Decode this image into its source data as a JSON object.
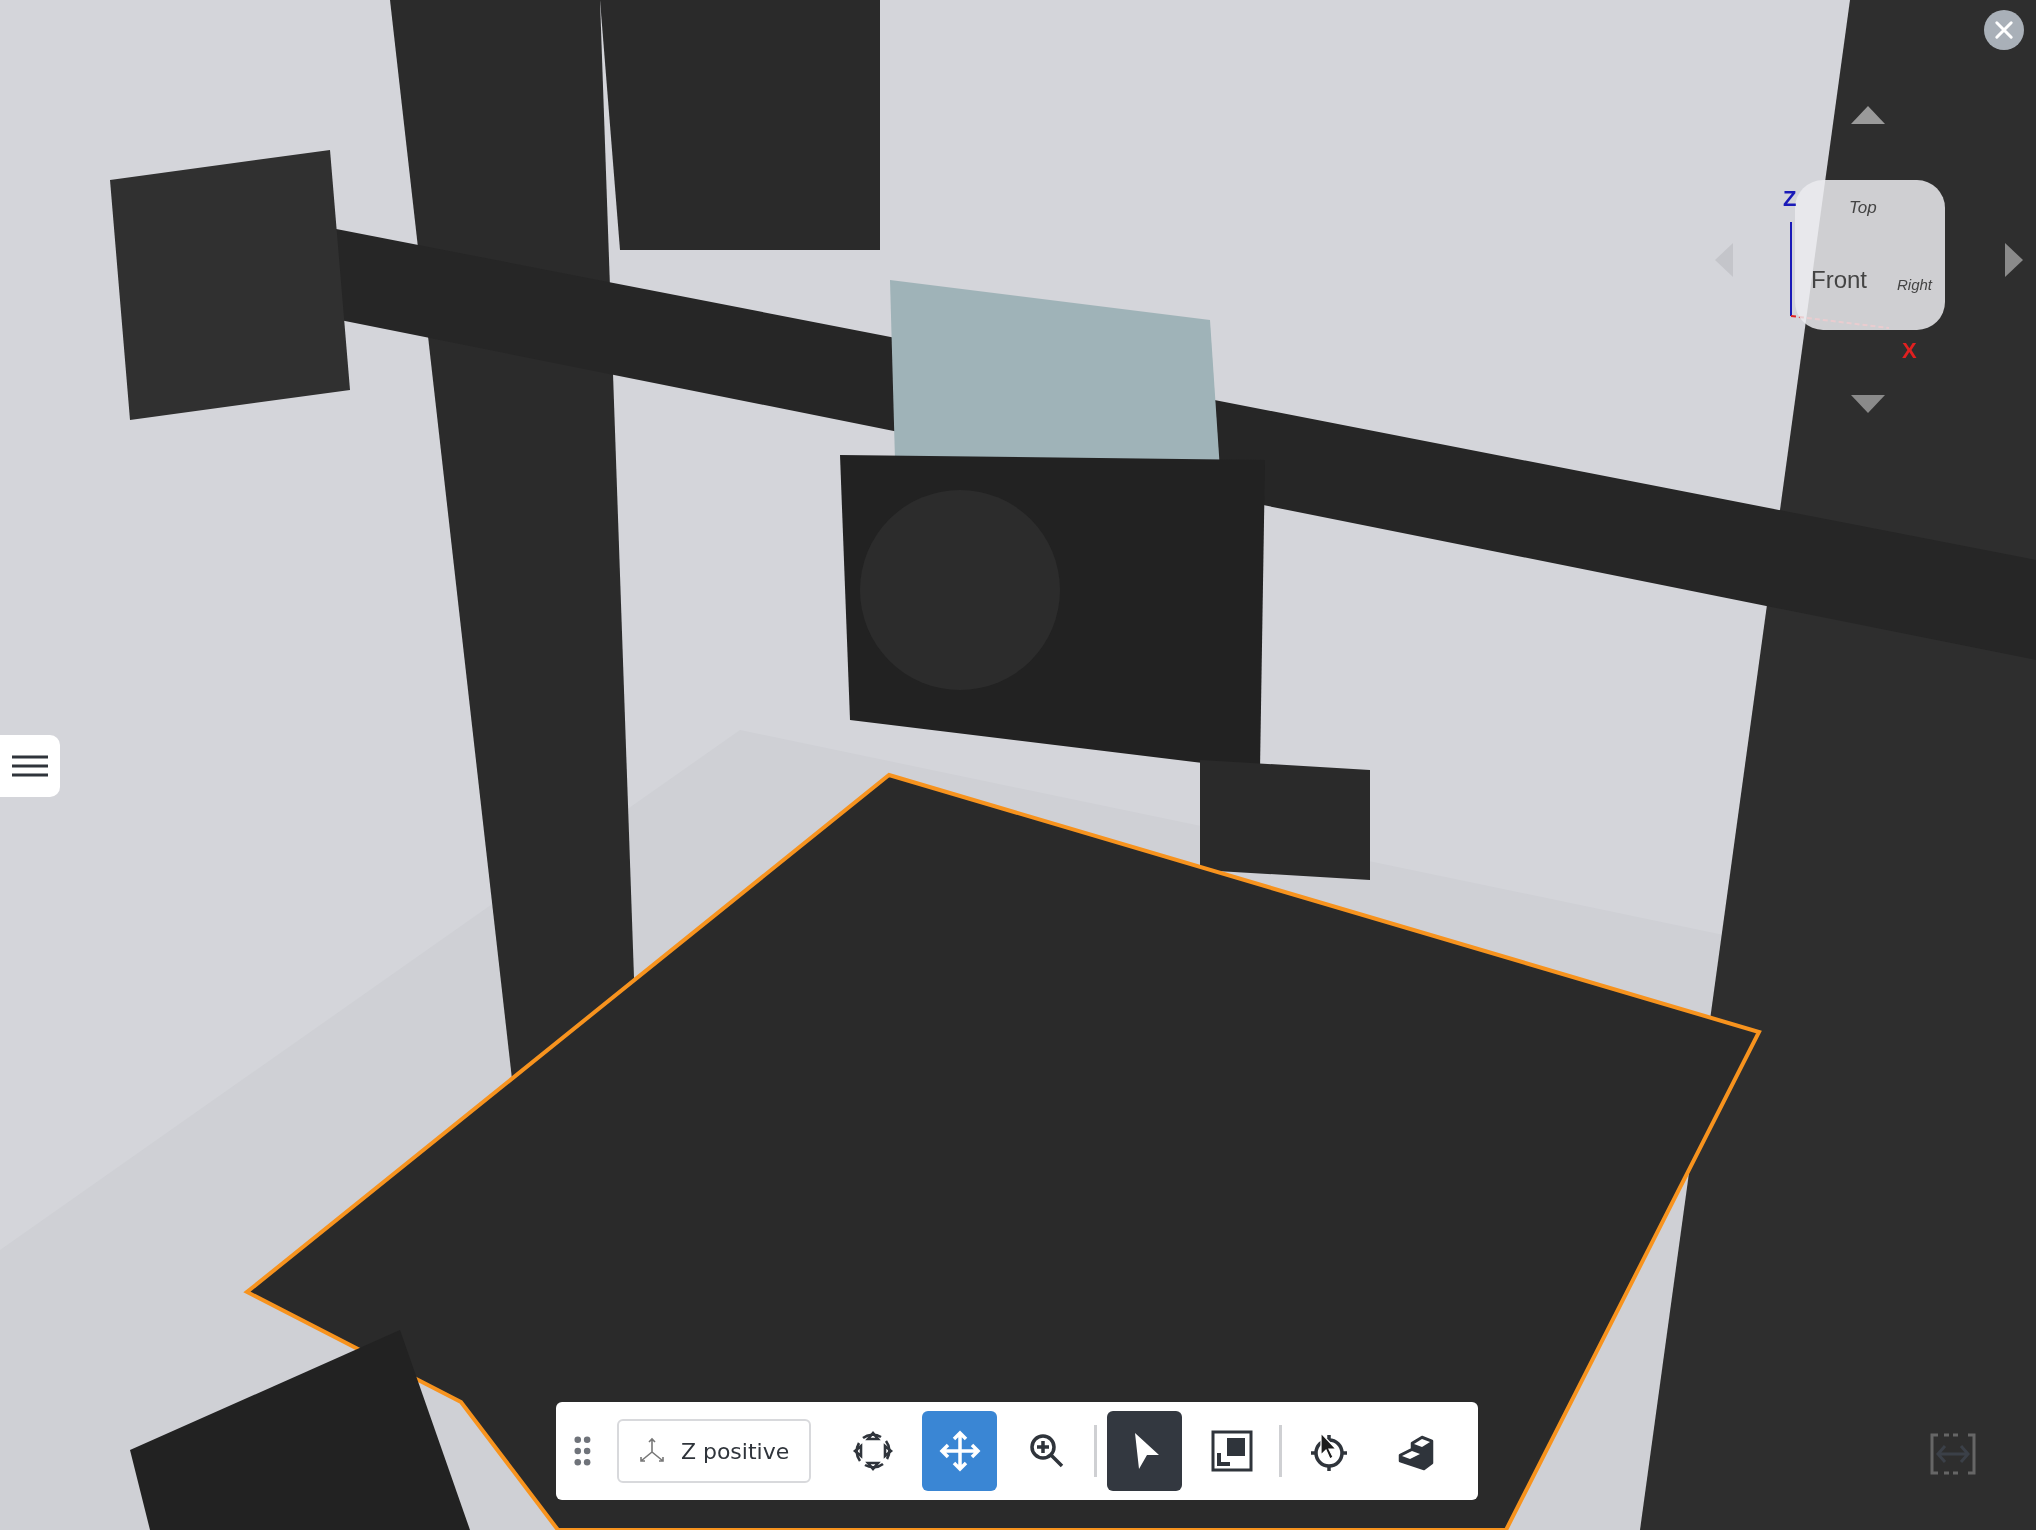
{
  "view_cube": {
    "faces": [
      "Top",
      "Front",
      "Right"
    ],
    "axes": [
      "Z",
      "X"
    ]
  },
  "toolbar": {
    "view_button": "Z positive",
    "navigation_tools": [
      {
        "kind": "rotate",
        "selected": false
      },
      {
        "kind": "pan",
        "selected": true
      },
      {
        "kind": "zoom",
        "selected": false
      }
    ],
    "selection_tools": [
      {
        "kind": "select",
        "selected": true
      },
      {
        "kind": "window",
        "selected": false
      }
    ]
  }
}
